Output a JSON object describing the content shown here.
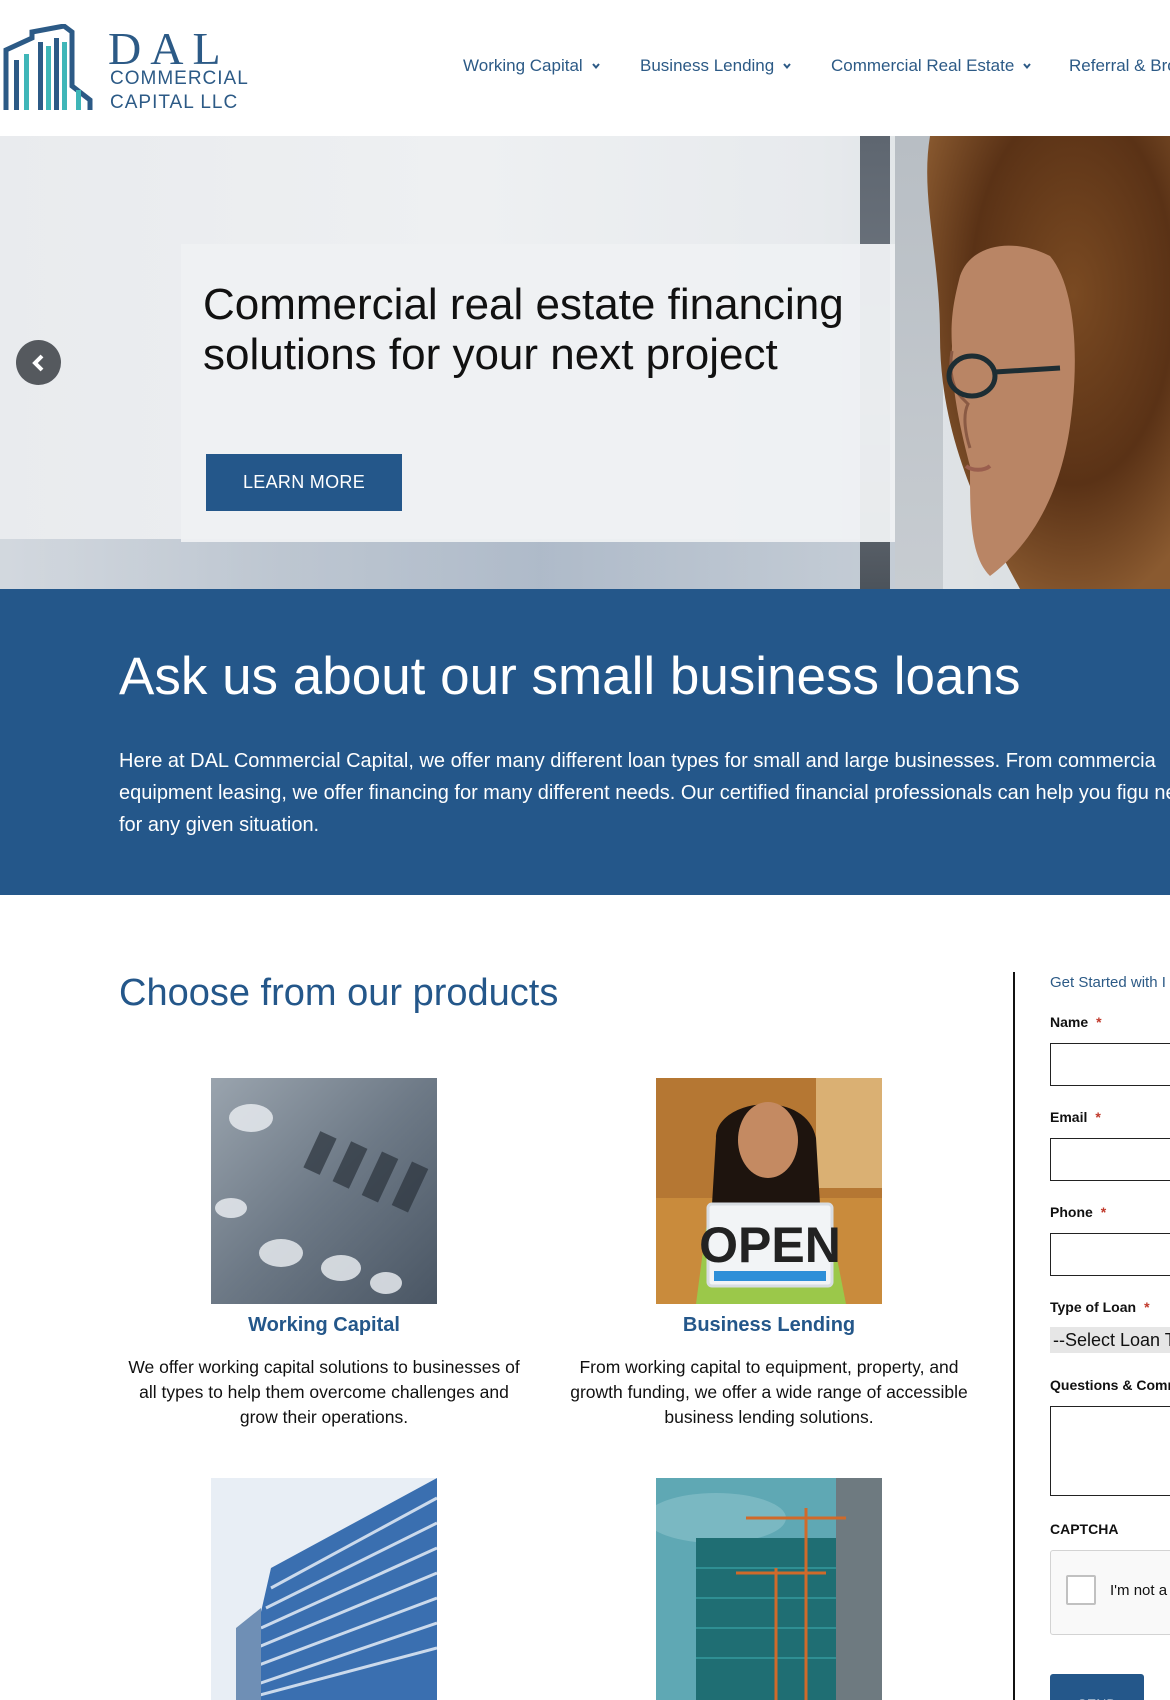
{
  "brand": {
    "name": "DAL",
    "line1": "COMMERCIAL",
    "line2": "CAPITAL LLC",
    "color": "#2c5a86",
    "accent": "#3fb6b8"
  },
  "nav": {
    "items": [
      {
        "label": "Working Capital"
      },
      {
        "label": "Business Lending"
      },
      {
        "label": "Commercial Real Estate"
      },
      {
        "label": "Referral & Bro"
      }
    ]
  },
  "hero": {
    "title": "Commercial real estate financing solutions for your next project",
    "button": "LEARN MORE",
    "prev_icon": "chevron-left-icon"
  },
  "band": {
    "title": "Ask us about our small business loans",
    "text": "Here at DAL Commercial Capital, we offer many different loan types for small and large businesses. From commercia equipment leasing, we offer financing for many different needs. Our certified financial professionals can help you figu need for any given situation.",
    "bg": "#24578a"
  },
  "products": {
    "title": "Choose from our products",
    "items": [
      {
        "name": "Working Capital",
        "desc": "We offer working capital solutions to businesses of all types to help them overcome challenges and grow their operations.",
        "image": "credit-card-closeup"
      },
      {
        "name": "Business Lending",
        "desc": "From working capital to equipment, property, and growth funding, we offer a wide range of accessible business lending solutions.",
        "image": "woman-holding-open-sign",
        "sign": "OPEN"
      },
      {
        "name": "",
        "desc": "",
        "image": "glass-office-building"
      },
      {
        "name": "",
        "desc": "",
        "image": "building-under-construction-cranes"
      }
    ]
  },
  "form": {
    "heading": "Get Started with I",
    "required_mark": "*",
    "name_label": "Name",
    "email_label": "Email",
    "phone_label": "Phone",
    "loan_label": "Type of Loan",
    "loan_selected": "--Select Loan T",
    "questions_label": "Questions & Comn",
    "captcha_label": "CAPTCHA",
    "captcha_text": "I'm not a",
    "send": "SEND"
  }
}
